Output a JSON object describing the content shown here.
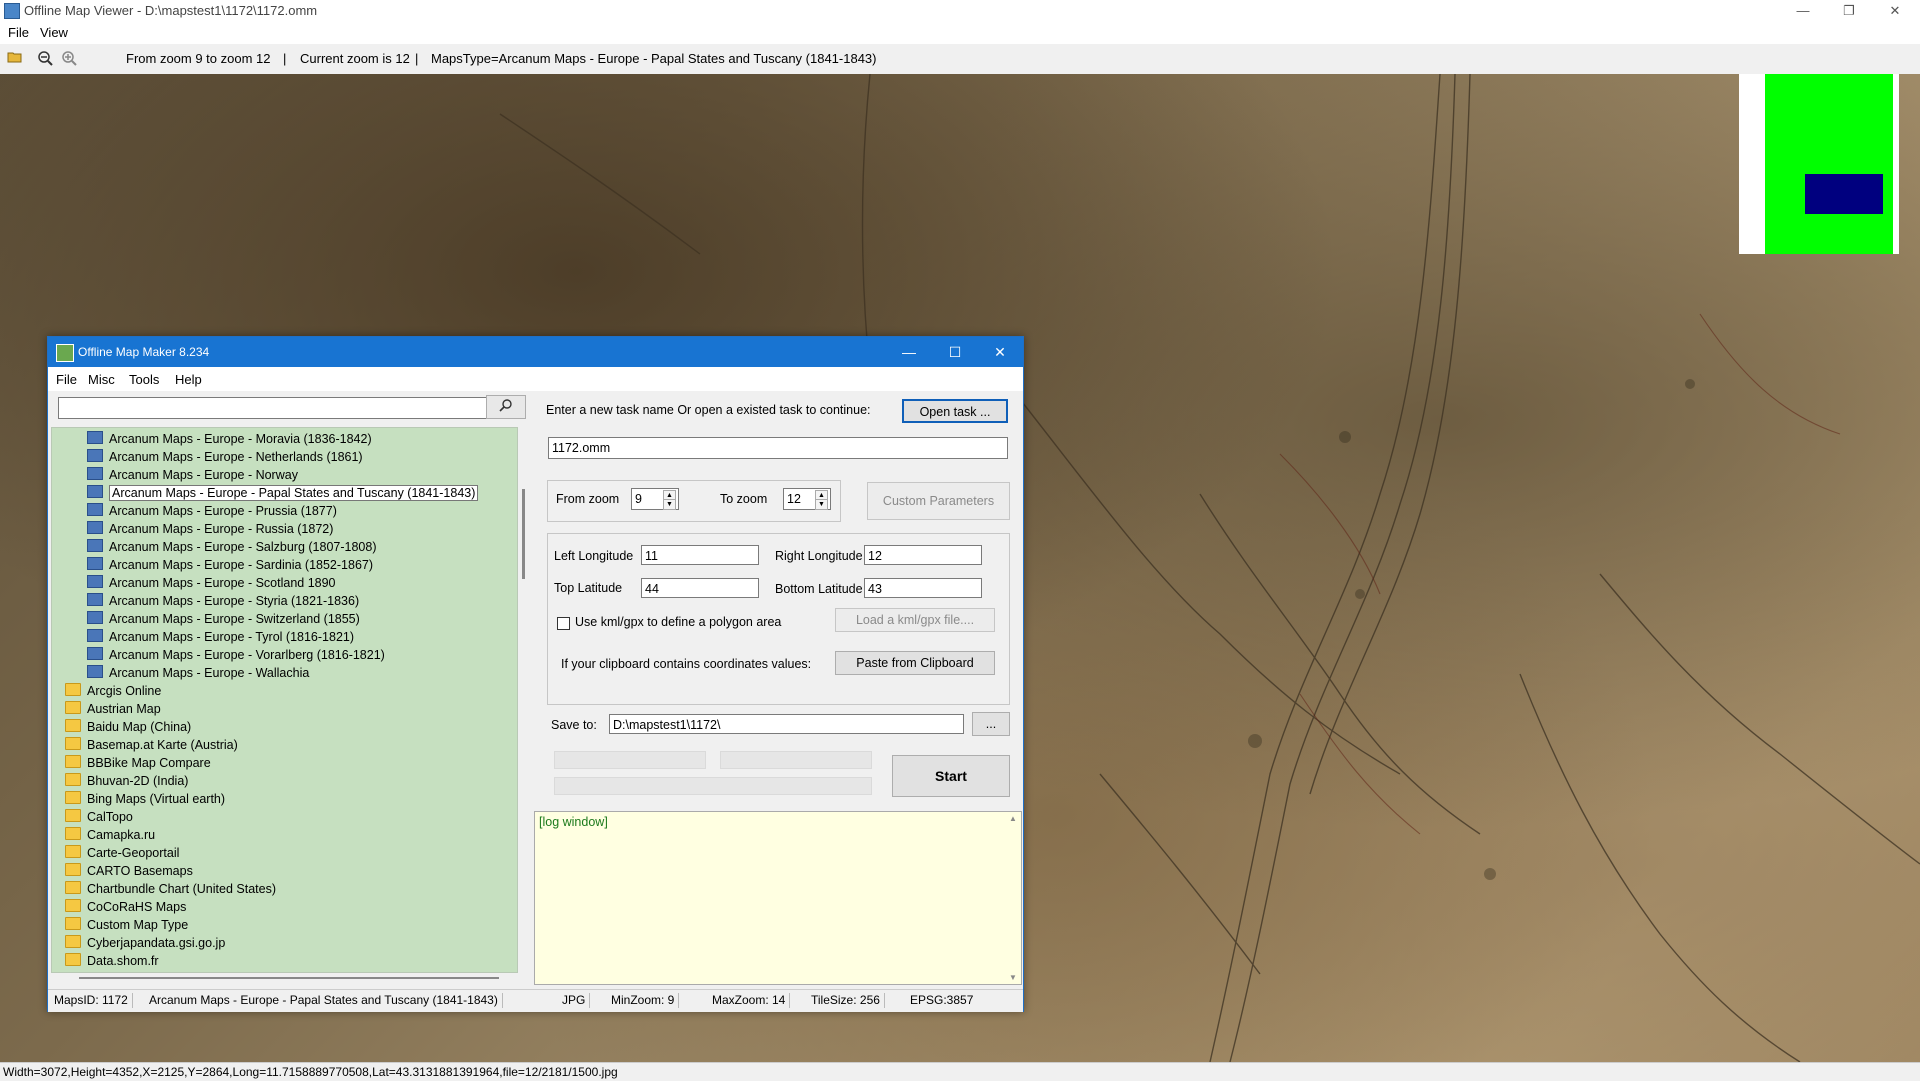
{
  "app": {
    "title": "Offline Map Viewer - D:\\mapstest1\\1172\\1172.omm",
    "menu": [
      "File",
      "View"
    ],
    "window_buttons": [
      "—",
      "❐",
      "✕"
    ]
  },
  "toolbar": {
    "zoom_range": "From zoom 9 to zoom 12",
    "sep1": "|",
    "current_zoom": "Current zoom is 12",
    "sep2": "|",
    "maps_type": "MapsType=Arcanum Maps - Europe - Papal States and Tuscany (1841-1843)"
  },
  "status_bar": {
    "text": "Width=3072,Height=4352,X=2125,Y=2864,Long=11.7158889770508,Lat=43.3131881391964,file=12/2181/1500.jpg"
  },
  "overview": {
    "colors": {
      "background": "#00ff00",
      "viewport": "#00007f"
    }
  },
  "dialog": {
    "title": "Offline Map Maker 8.234",
    "window_buttons": [
      "—",
      "☐",
      "✕"
    ],
    "menu": [
      "File",
      "Misc",
      "Tools",
      "Help"
    ],
    "search": {
      "value": "",
      "button_icon": "search-icon"
    },
    "tree_items": [
      {
        "label": "Arcanum Maps - Europe - Moravia (1836-1842)",
        "type": "map"
      },
      {
        "label": "Arcanum Maps - Europe - Netherlands (1861)",
        "type": "map"
      },
      {
        "label": "Arcanum Maps - Europe - Norway",
        "type": "map"
      },
      {
        "label": "Arcanum Maps - Europe - Papal States and Tuscany (1841-1843)",
        "type": "map",
        "selected": true
      },
      {
        "label": "Arcanum Maps - Europe - Prussia (1877)",
        "type": "map"
      },
      {
        "label": "Arcanum Maps - Europe - Russia (1872)",
        "type": "map"
      },
      {
        "label": "Arcanum Maps - Europe - Salzburg (1807-1808)",
        "type": "map"
      },
      {
        "label": "Arcanum Maps - Europe - Sardinia (1852-1867)",
        "type": "map"
      },
      {
        "label": "Arcanum Maps - Europe - Scotland 1890",
        "type": "map"
      },
      {
        "label": "Arcanum Maps - Europe - Styria (1821-1836)",
        "type": "map"
      },
      {
        "label": "Arcanum Maps - Europe - Switzerland (1855)",
        "type": "map"
      },
      {
        "label": "Arcanum Maps - Europe - Tyrol (1816-1821)",
        "type": "map"
      },
      {
        "label": "Arcanum Maps - Europe - Vorarlberg (1816-1821)",
        "type": "map"
      },
      {
        "label": "Arcanum Maps - Europe - Wallachia",
        "type": "map"
      },
      {
        "label": "Arcgis Online",
        "type": "folder"
      },
      {
        "label": "Austrian Map",
        "type": "folder"
      },
      {
        "label": "Baidu Map (China)",
        "type": "folder"
      },
      {
        "label": "Basemap.at Karte (Austria)",
        "type": "folder"
      },
      {
        "label": "BBBike Map Compare",
        "type": "folder"
      },
      {
        "label": "Bhuvan-2D (India)",
        "type": "folder"
      },
      {
        "label": "Bing Maps (Virtual earth)",
        "type": "folder"
      },
      {
        "label": "CalTopo",
        "type": "folder"
      },
      {
        "label": "Camapka.ru",
        "type": "folder"
      },
      {
        "label": "Carte-Geoportail",
        "type": "folder"
      },
      {
        "label": "CARTO Basemaps",
        "type": "folder"
      },
      {
        "label": "Chartbundle Chart (United States)",
        "type": "folder"
      },
      {
        "label": "CoCoRaHS Maps",
        "type": "folder"
      },
      {
        "label": "Custom Map Type",
        "type": "folder"
      },
      {
        "label": "Cyberjapandata.gsi.go.jp",
        "type": "folder"
      },
      {
        "label": "Data.shom.fr",
        "type": "folder"
      }
    ],
    "task": {
      "prompt": "Enter a new task name Or open a existed task to continue:",
      "open_button": "Open task ...",
      "name": "1172.omm"
    },
    "zoom": {
      "from_label": "From zoom",
      "from_value": "9",
      "to_label": "To zoom",
      "to_value": "12",
      "custom_button": "Custom Parameters"
    },
    "coords": {
      "left_lon_label": "Left Longitude",
      "left_lon": "11",
      "right_lon_label": "Right Longitude",
      "right_lon": "12",
      "top_lat_label": "Top Latitude",
      "top_lat": "44",
      "bottom_lat_label": "Bottom Latitude",
      "bottom_lat": "43",
      "kml_checkbox": "Use kml/gpx to define a polygon area",
      "kml_button": "Load a kml/gpx file....",
      "clipboard_label": "If your clipboard contains coordinates values:",
      "clipboard_button": "Paste from Clipboard"
    },
    "save": {
      "label": "Save to:",
      "path": "D:\\mapstest1\\1172\\",
      "browse": "..."
    },
    "start_button": "Start",
    "log": "[log window]",
    "status": {
      "maps_id": "MapsID: 1172",
      "name": "Arcanum Maps - Europe - Papal States and Tuscany (1841-1843)",
      "format": "JPG",
      "min_zoom": "MinZoom: 9",
      "max_zoom": "MaxZoom: 14",
      "tile_size": "TileSize: 256",
      "epsg": "EPSG:3857"
    }
  }
}
